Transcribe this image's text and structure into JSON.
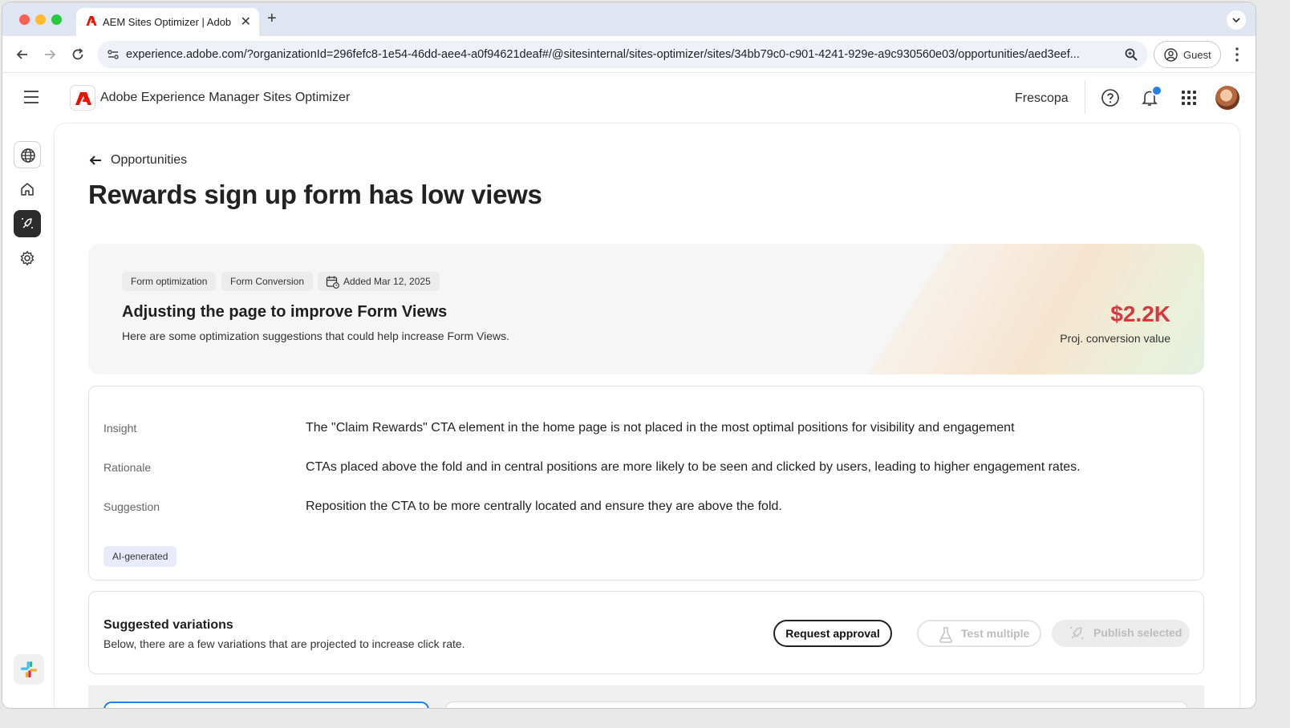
{
  "browser": {
    "tab_title": "AEM Sites Optimizer | Adobe Experience Manager",
    "tab_close": "✕",
    "new_tab": "+",
    "url": "experience.adobe.com/?organizationId=296fefc8-1e54-46dd-aee4-a0f94621deaf#/@sitesinternal/sites-optimizer/sites/34bb79c0-c901-4241-929e-a9c930560e03/opportunities/aed3eef...",
    "guest_label": "Guest"
  },
  "header": {
    "app_title": "Adobe Experience Manager Sites Optimizer",
    "org_name": "Frescopa"
  },
  "page": {
    "back_label": "Opportunities",
    "title": "Rewards sign up form has low views"
  },
  "hero": {
    "chips": [
      "Form optimization",
      "Form Conversion",
      "Added Mar 12, 2025"
    ],
    "title": "Adjusting the page to improve Form Views",
    "subtitle": "Here are some optimization suggestions that could help increase Form Views.",
    "metric_value": "$2.2K",
    "metric_label": "Proj. conversion value"
  },
  "insight": {
    "rows": [
      {
        "label": "Insight",
        "text": "The \"Claim Rewards\" CTA element in the home page is not placed in the most optimal positions for visibility and engagement"
      },
      {
        "label": "Rationale",
        "text": "CTAs placed above the fold and in central positions are more likely to be seen and clicked by users, leading to higher engagement rates."
      },
      {
        "label": "Suggestion",
        "text": "Reposition the CTA to be more centrally located and ensure they are above the fold."
      }
    ],
    "badge": "AI-generated"
  },
  "variations": {
    "title": "Suggested variations",
    "subtitle": "Below, there are a few variations that are projected to increase click rate.",
    "request_approval": "Request approval",
    "test_multiple": "Test multiple",
    "publish_selected": "Publish selected"
  },
  "icons": {
    "rail": [
      "globe-icon",
      "home-icon",
      "opportunities-icon",
      "settings-icon",
      "slack-icon"
    ],
    "header": [
      "hamburger-icon",
      "adobe-logo",
      "help-icon",
      "bell-icon",
      "apps-grid-icon"
    ]
  },
  "colors": {
    "accent_red": "#d7373f",
    "notification_blue": "#2680eb",
    "rail_active": "#2c2c2c"
  }
}
